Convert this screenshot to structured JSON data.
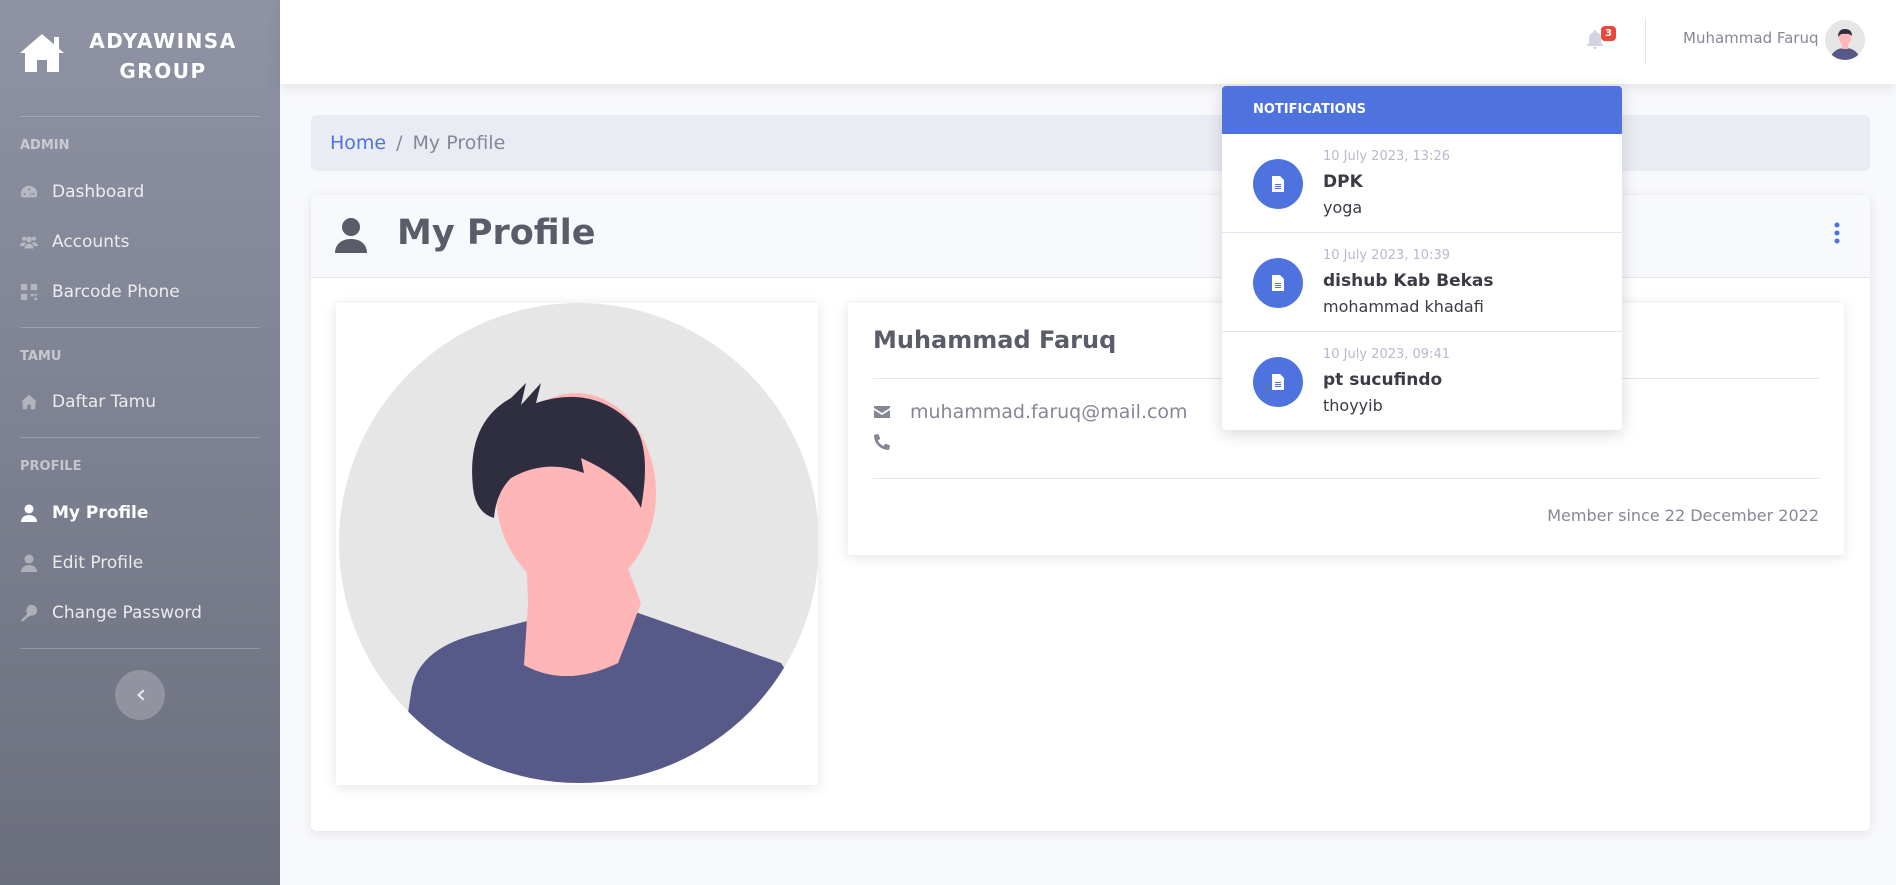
{
  "brand": {
    "line1": "ADYAWINSA",
    "line2": "GROUP",
    "icon": "home-icon"
  },
  "sidebar": {
    "sections": [
      {
        "heading": "ADMIN",
        "items": [
          {
            "label": "Dashboard",
            "icon": "dashboard-icon"
          },
          {
            "label": "Accounts",
            "icon": "users-icon"
          },
          {
            "label": "Barcode Phone",
            "icon": "barcode-icon"
          }
        ]
      },
      {
        "heading": "TAMU",
        "items": [
          {
            "label": "Daftar Tamu",
            "icon": "home-icon"
          }
        ]
      },
      {
        "heading": "PROFILE",
        "items": [
          {
            "label": "My Profile",
            "icon": "user-icon",
            "active": true
          },
          {
            "label": "Edit Profile",
            "icon": "user-icon"
          },
          {
            "label": "Change Password",
            "icon": "key-icon"
          }
        ]
      }
    ],
    "toggle_icon": "chevron-left-icon"
  },
  "topbar": {
    "notif_count": "3",
    "user_name": "Muhammad Faruq"
  },
  "breadcrumb": {
    "home": "Home",
    "separator": "/",
    "current": "My Profile"
  },
  "card": {
    "title": "My Profile"
  },
  "profile": {
    "name": "Muhammad Faruq",
    "email": "muhammad.faruq@mail.com",
    "phone": "",
    "member_since": "Member since 22 December 2022"
  },
  "notifications": {
    "heading": "NOTIFICATIONS",
    "items": [
      {
        "time": "10 July 2023, 13:26",
        "title": "DPK",
        "subtitle": "yoga"
      },
      {
        "time": "10 July 2023, 10:39",
        "title": "dishub Kab Bekas",
        "subtitle": "mohammad khadafi"
      },
      {
        "time": "10 July 2023, 09:41",
        "title": "pt sucufindo",
        "subtitle": "thoyyib"
      }
    ]
  },
  "colors": {
    "primary": "#4e73df",
    "danger": "#e74a3b",
    "sidebar_top": "#8f93a4",
    "sidebar_bottom": "#6b6e7d"
  }
}
